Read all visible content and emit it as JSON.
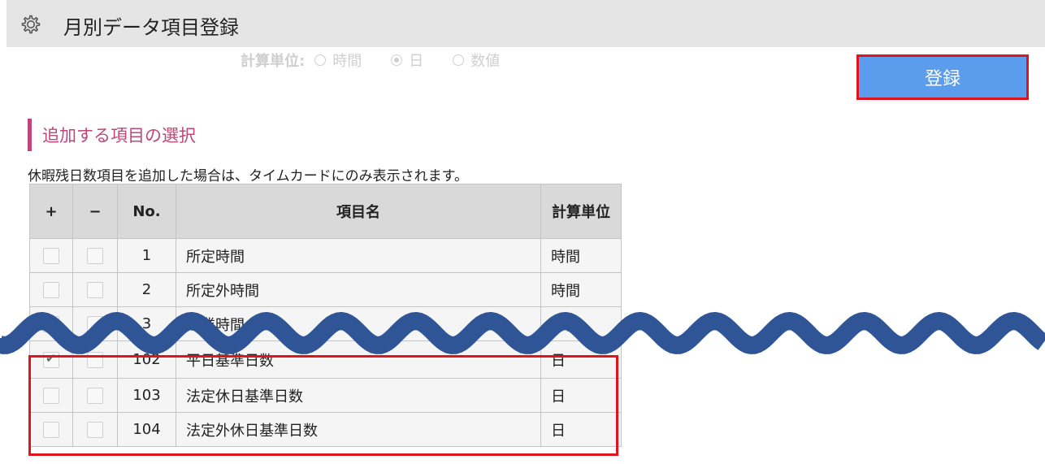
{
  "header": {
    "title": "月別データ項目登録",
    "icon": "gear-icon"
  },
  "calc_unit": {
    "label": "計算単位:",
    "options": [
      {
        "label": "時間",
        "checked": false
      },
      {
        "label": "日",
        "checked": true
      },
      {
        "label": "数値",
        "checked": false
      }
    ]
  },
  "register_button": {
    "label": "登録",
    "color": "#5c9cec"
  },
  "section": {
    "title": "追加する項目の選択",
    "accent": "#c0457a"
  },
  "note": "休暇残日数項目を追加した場合は、タイムカードにのみ表示されます。",
  "table": {
    "headers": {
      "add": "+",
      "remove": "−",
      "no": "No.",
      "name": "項目名",
      "unit": "計算単位"
    },
    "rows": [
      {
        "add": false,
        "remove": false,
        "no": "1",
        "name": "所定時間",
        "unit": "時間"
      },
      {
        "add": false,
        "remove": false,
        "no": "2",
        "name": "所定外時間",
        "unit": "時間"
      },
      {
        "add": false,
        "remove": false,
        "no": "3",
        "name": "残業時間",
        "unit": "時間"
      },
      {
        "add": true,
        "remove": false,
        "no": "102",
        "name": "平日基準日数",
        "unit": "日"
      },
      {
        "add": false,
        "remove": false,
        "no": "103",
        "name": "法定休日基準日数",
        "unit": "日"
      },
      {
        "add": false,
        "remove": false,
        "no": "104",
        "name": "法定外休日基準日数",
        "unit": "日"
      }
    ]
  },
  "colors": {
    "highlight": "#e0141e",
    "wave": "#2f5597"
  }
}
